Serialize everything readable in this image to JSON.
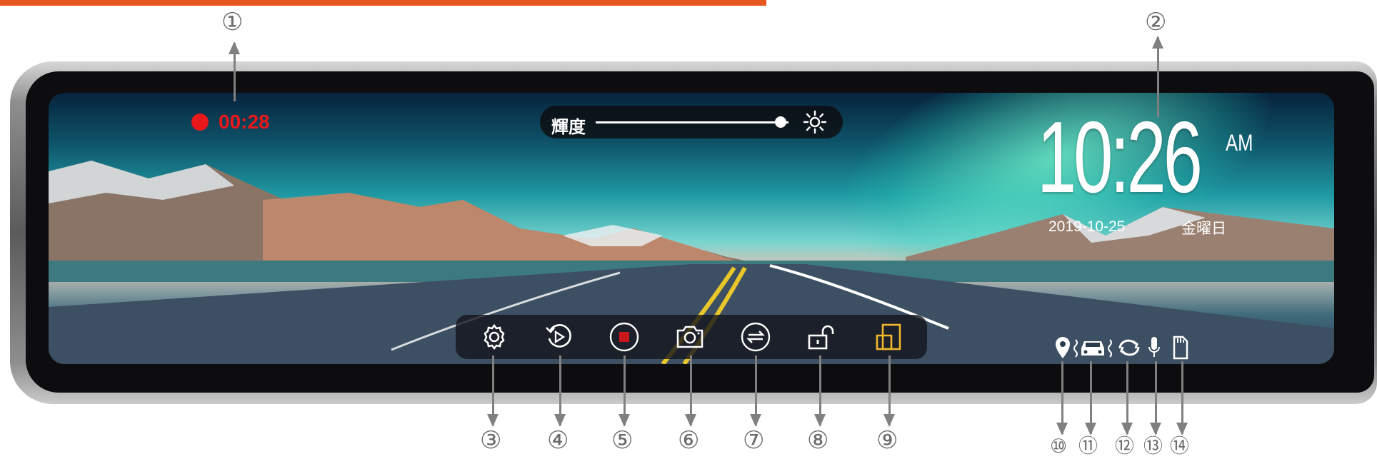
{
  "recording": {
    "elapsed": "00:28"
  },
  "brightness": {
    "label": "輝度",
    "level": 0.96
  },
  "clock": {
    "time": "10:26",
    "ampm": "AM",
    "date": "2019-10-25",
    "weekday": "金曜日"
  },
  "toolbar": {
    "buttons": [
      {
        "icon": "settings-gear-icon"
      },
      {
        "icon": "playback-icon"
      },
      {
        "icon": "record-stop-icon"
      },
      {
        "icon": "camera-icon"
      },
      {
        "icon": "switch-camera-icon"
      },
      {
        "icon": "unlock-icon"
      },
      {
        "icon": "split-screen-icon"
      }
    ]
  },
  "status_icons": [
    "gps-icon",
    "parking-monitor-icon",
    "loop-recording-icon",
    "microphone-icon",
    "sd-card-icon"
  ],
  "callouts": [
    "①",
    "②",
    "③",
    "④",
    "⑤",
    "⑥",
    "⑦",
    "⑧",
    "⑨",
    "⑩",
    "⑪",
    "⑫",
    "⑬",
    "⑭"
  ],
  "colors": {
    "accent_bar": "#e8561f",
    "recording_red": "#e8181c",
    "split_yellow": "#f1b82c",
    "callout_gray": "#808080"
  }
}
